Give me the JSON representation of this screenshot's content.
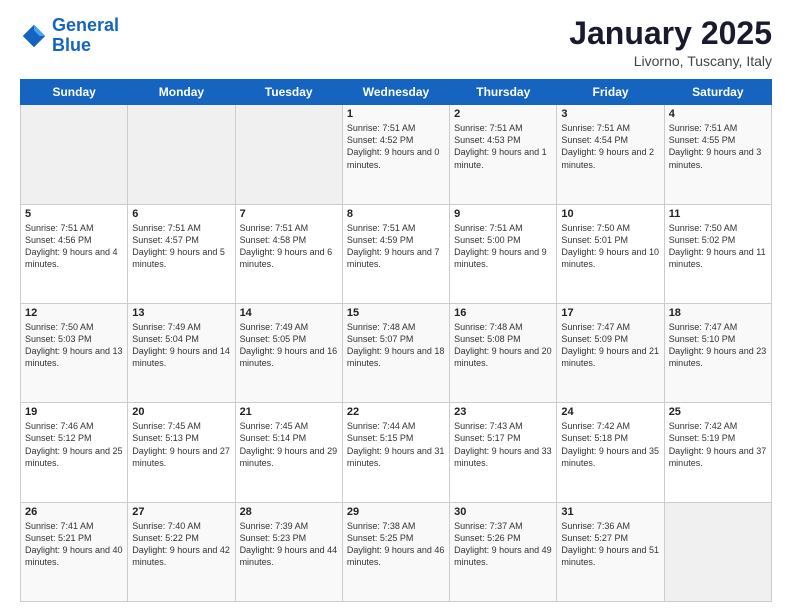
{
  "logo": {
    "line1": "General",
    "line2": "Blue"
  },
  "title": "January 2025",
  "subtitle": "Livorno, Tuscany, Italy",
  "days_of_week": [
    "Sunday",
    "Monday",
    "Tuesday",
    "Wednesday",
    "Thursday",
    "Friday",
    "Saturday"
  ],
  "weeks": [
    [
      {
        "day": "",
        "sunrise": "",
        "sunset": "",
        "daylight": ""
      },
      {
        "day": "",
        "sunrise": "",
        "sunset": "",
        "daylight": ""
      },
      {
        "day": "",
        "sunrise": "",
        "sunset": "",
        "daylight": ""
      },
      {
        "day": "1",
        "sunrise": "Sunrise: 7:51 AM",
        "sunset": "Sunset: 4:52 PM",
        "daylight": "Daylight: 9 hours and 0 minutes."
      },
      {
        "day": "2",
        "sunrise": "Sunrise: 7:51 AM",
        "sunset": "Sunset: 4:53 PM",
        "daylight": "Daylight: 9 hours and 1 minute."
      },
      {
        "day": "3",
        "sunrise": "Sunrise: 7:51 AM",
        "sunset": "Sunset: 4:54 PM",
        "daylight": "Daylight: 9 hours and 2 minutes."
      },
      {
        "day": "4",
        "sunrise": "Sunrise: 7:51 AM",
        "sunset": "Sunset: 4:55 PM",
        "daylight": "Daylight: 9 hours and 3 minutes."
      }
    ],
    [
      {
        "day": "5",
        "sunrise": "Sunrise: 7:51 AM",
        "sunset": "Sunset: 4:56 PM",
        "daylight": "Daylight: 9 hours and 4 minutes."
      },
      {
        "day": "6",
        "sunrise": "Sunrise: 7:51 AM",
        "sunset": "Sunset: 4:57 PM",
        "daylight": "Daylight: 9 hours and 5 minutes."
      },
      {
        "day": "7",
        "sunrise": "Sunrise: 7:51 AM",
        "sunset": "Sunset: 4:58 PM",
        "daylight": "Daylight: 9 hours and 6 minutes."
      },
      {
        "day": "8",
        "sunrise": "Sunrise: 7:51 AM",
        "sunset": "Sunset: 4:59 PM",
        "daylight": "Daylight: 9 hours and 7 minutes."
      },
      {
        "day": "9",
        "sunrise": "Sunrise: 7:51 AM",
        "sunset": "Sunset: 5:00 PM",
        "daylight": "Daylight: 9 hours and 9 minutes."
      },
      {
        "day": "10",
        "sunrise": "Sunrise: 7:50 AM",
        "sunset": "Sunset: 5:01 PM",
        "daylight": "Daylight: 9 hours and 10 minutes."
      },
      {
        "day": "11",
        "sunrise": "Sunrise: 7:50 AM",
        "sunset": "Sunset: 5:02 PM",
        "daylight": "Daylight: 9 hours and 11 minutes."
      }
    ],
    [
      {
        "day": "12",
        "sunrise": "Sunrise: 7:50 AM",
        "sunset": "Sunset: 5:03 PM",
        "daylight": "Daylight: 9 hours and 13 minutes."
      },
      {
        "day": "13",
        "sunrise": "Sunrise: 7:49 AM",
        "sunset": "Sunset: 5:04 PM",
        "daylight": "Daylight: 9 hours and 14 minutes."
      },
      {
        "day": "14",
        "sunrise": "Sunrise: 7:49 AM",
        "sunset": "Sunset: 5:05 PM",
        "daylight": "Daylight: 9 hours and 16 minutes."
      },
      {
        "day": "15",
        "sunrise": "Sunrise: 7:48 AM",
        "sunset": "Sunset: 5:07 PM",
        "daylight": "Daylight: 9 hours and 18 minutes."
      },
      {
        "day": "16",
        "sunrise": "Sunrise: 7:48 AM",
        "sunset": "Sunset: 5:08 PM",
        "daylight": "Daylight: 9 hours and 20 minutes."
      },
      {
        "day": "17",
        "sunrise": "Sunrise: 7:47 AM",
        "sunset": "Sunset: 5:09 PM",
        "daylight": "Daylight: 9 hours and 21 minutes."
      },
      {
        "day": "18",
        "sunrise": "Sunrise: 7:47 AM",
        "sunset": "Sunset: 5:10 PM",
        "daylight": "Daylight: 9 hours and 23 minutes."
      }
    ],
    [
      {
        "day": "19",
        "sunrise": "Sunrise: 7:46 AM",
        "sunset": "Sunset: 5:12 PM",
        "daylight": "Daylight: 9 hours and 25 minutes."
      },
      {
        "day": "20",
        "sunrise": "Sunrise: 7:45 AM",
        "sunset": "Sunset: 5:13 PM",
        "daylight": "Daylight: 9 hours and 27 minutes."
      },
      {
        "day": "21",
        "sunrise": "Sunrise: 7:45 AM",
        "sunset": "Sunset: 5:14 PM",
        "daylight": "Daylight: 9 hours and 29 minutes."
      },
      {
        "day": "22",
        "sunrise": "Sunrise: 7:44 AM",
        "sunset": "Sunset: 5:15 PM",
        "daylight": "Daylight: 9 hours and 31 minutes."
      },
      {
        "day": "23",
        "sunrise": "Sunrise: 7:43 AM",
        "sunset": "Sunset: 5:17 PM",
        "daylight": "Daylight: 9 hours and 33 minutes."
      },
      {
        "day": "24",
        "sunrise": "Sunrise: 7:42 AM",
        "sunset": "Sunset: 5:18 PM",
        "daylight": "Daylight: 9 hours and 35 minutes."
      },
      {
        "day": "25",
        "sunrise": "Sunrise: 7:42 AM",
        "sunset": "Sunset: 5:19 PM",
        "daylight": "Daylight: 9 hours and 37 minutes."
      }
    ],
    [
      {
        "day": "26",
        "sunrise": "Sunrise: 7:41 AM",
        "sunset": "Sunset: 5:21 PM",
        "daylight": "Daylight: 9 hours and 40 minutes."
      },
      {
        "day": "27",
        "sunrise": "Sunrise: 7:40 AM",
        "sunset": "Sunset: 5:22 PM",
        "daylight": "Daylight: 9 hours and 42 minutes."
      },
      {
        "day": "28",
        "sunrise": "Sunrise: 7:39 AM",
        "sunset": "Sunset: 5:23 PM",
        "daylight": "Daylight: 9 hours and 44 minutes."
      },
      {
        "day": "29",
        "sunrise": "Sunrise: 7:38 AM",
        "sunset": "Sunset: 5:25 PM",
        "daylight": "Daylight: 9 hours and 46 minutes."
      },
      {
        "day": "30",
        "sunrise": "Sunrise: 7:37 AM",
        "sunset": "Sunset: 5:26 PM",
        "daylight": "Daylight: 9 hours and 49 minutes."
      },
      {
        "day": "31",
        "sunrise": "Sunrise: 7:36 AM",
        "sunset": "Sunset: 5:27 PM",
        "daylight": "Daylight: 9 hours and 51 minutes."
      },
      {
        "day": "",
        "sunrise": "",
        "sunset": "",
        "daylight": ""
      }
    ]
  ]
}
